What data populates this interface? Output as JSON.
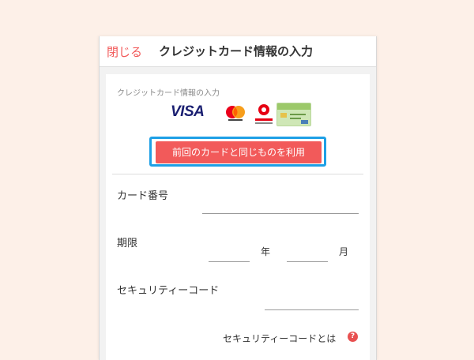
{
  "header": {
    "close_label": "閉じる",
    "title": "クレジットカード情報の入力"
  },
  "card": {
    "section_label": "クレジットカード情報の入力",
    "logos": {
      "visa": "VISA",
      "mastercard_icon": "mastercard-logo-icon",
      "pocketcard_icon": "pocketcard-logo-icon",
      "green_card_icon": "green-card-icon"
    },
    "reuse_button_label": "前回のカードと同じものを利用",
    "highlight_color": "#1ea0e6",
    "accent_color": "#f25a5a"
  },
  "form": {
    "card_number_label": "カード番号",
    "expiry_label": "期限",
    "year_unit": "年",
    "month_unit": "月",
    "security_code_label": "セキュリティーコード",
    "security_help_label": "セキュリティーコードとは",
    "help_icon": "?"
  }
}
